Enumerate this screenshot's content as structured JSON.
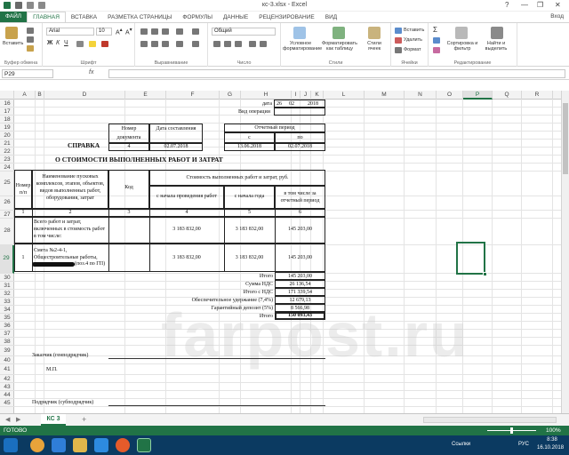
{
  "window": {
    "title": "кс-3.xlsx - Excel",
    "help": "?",
    "min": "—",
    "max": "❐",
    "close": "✕"
  },
  "ribbon": {
    "file_tab": "ФАЙЛ",
    "tabs": [
      "ГЛАВНАЯ",
      "ВСТАВКА",
      "РАЗМЕТКА СТРАНИЦЫ",
      "ФОРМУЛЫ",
      "ДАННЫЕ",
      "РЕЦЕНЗИРОВАНИЕ",
      "ВИД"
    ],
    "sign_in": "Вход",
    "paste": "Вставить",
    "clipboard_group": "Буфер обмена",
    "font_name": "Arial",
    "font_size": "10",
    "font_group": "Шрифт",
    "align_group": "Выравнивание",
    "number_format": "Общий",
    "number_group": "Число",
    "cond_format": "Условное форматирование",
    "format_table": "Форматировать как таблицу",
    "cell_styles": "Стили ячеек",
    "styles_group": "Стили",
    "insert": "Вставить",
    "delete": "Удалить",
    "format": "Формат",
    "cells_group": "Ячейки",
    "sort_filter": "Сортировка и фильтр",
    "find_select": "Найти и выделить",
    "editing_group": "Редактирование"
  },
  "formula_bar": {
    "name_box": "P29",
    "fx": "fx",
    "value": ""
  },
  "columns": [
    "A",
    "B",
    "D",
    "E",
    "F",
    "G",
    "H",
    "I",
    "J",
    "K",
    "L",
    "M",
    "N",
    "O",
    "P",
    "Q",
    "R"
  ],
  "selected_column": "P",
  "rows": [
    "16",
    "17",
    "18",
    "19",
    "20",
    "21",
    "22",
    "23",
    "24",
    "25",
    "26",
    "27",
    "28",
    "29",
    "30",
    "31",
    "32",
    "33",
    "34",
    "35",
    "36",
    "37",
    "38",
    "39",
    "40",
    "41",
    "42",
    "43",
    "44",
    "45"
  ],
  "selected_row": "29",
  "doc": {
    "date_label": "дата",
    "date_d": "26",
    "date_m": "02",
    "date_y": "2018",
    "operation_label": "Вид операции",
    "doc_num_hdr": "Номер документа",
    "doc_date_hdr": "Дата составления",
    "period_hdr": "Отчетный период",
    "period_from": "с",
    "period_to": "по",
    "spravka": "СПРАВКА",
    "doc_num": "4",
    "doc_date": "02.07.2018",
    "period_from_val": "13.06.2018",
    "period_to_val": "02.07.2018",
    "title": "О СТОИМОСТИ ВЫПОЛНЕННЫХ РАБОТ И ЗАТРАТ",
    "h_num": "Номер п/п",
    "h_name": "Наименование пусковых комплексов, этапов, объектов, видов выполненных работ, оборудования, затрат",
    "h_code": "Код",
    "h_cost": "Стоимость выполненных работ и затрат, руб.",
    "h_from_start": "с начала проведения работ",
    "h_from_year": "с начала года",
    "h_incl": "в том числе за отчетный период",
    "n1": "1",
    "n2": "2",
    "n3": "3",
    "n4": "4",
    "n5": "5",
    "n6": "6",
    "r28_text": "Всего работ и затрат, включенных в стоимость работ в том числе:",
    "r28_v1": "3 183 832,00",
    "r28_v2": "3 183 832,00",
    "r28_v3": "145 203,00",
    "r29_num": "1",
    "r29_text": "Смета №2-4-1, Общестроительные работы,",
    "r29_tail": "(поз.4 по ГП)",
    "r29_v1": "3 183 832,00",
    "r29_v2": "3 183 832,00",
    "r29_v3": "145 203,00",
    "itogo": "Итого",
    "itogo_v": "145 203,00",
    "nds": "Сумма НДС",
    "nds_v": "26 136,54",
    "itogo_nds": "Итого с НДС",
    "itogo_nds_v": "171 339,54",
    "obesp": "Обеспечительное удержание (7,4%)",
    "obesp_v": "12 679,13",
    "garant": "Гарантийный депозит (5%)",
    "garant_v": "8 566,98",
    "itogo2": "Итого",
    "itogo2_v": "150 093,43",
    "customer": "Заказчик (генподрядчик)",
    "mp": "М.П.",
    "contractor": "Подрядчик (субподрядчик)"
  },
  "sheet_tab": "КС 3",
  "add_sheet": "+",
  "status": {
    "ready": "ГОТОВО",
    "zoom": "100%"
  },
  "taskbar": {
    "lang": "РУС",
    "time": "8:38",
    "date": "16.10.2018",
    "links": "Ссылки"
  },
  "watermark": "farpost.ru"
}
